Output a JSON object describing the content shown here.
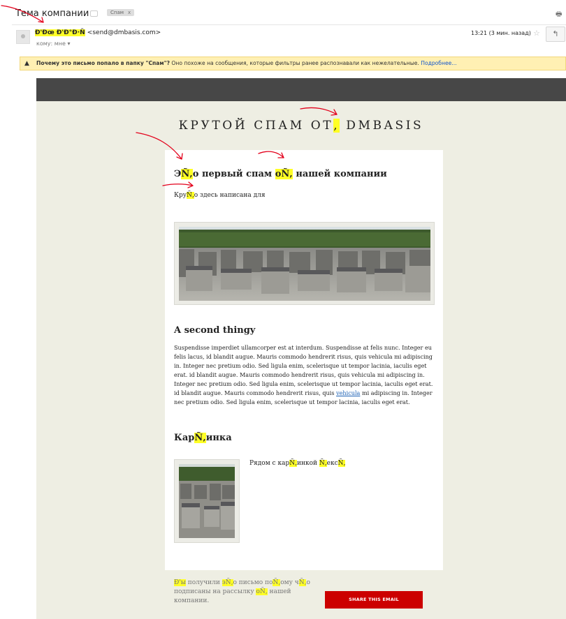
{
  "header": {
    "subject": "Тема компании",
    "label_chip": "Спам",
    "label_chip_close": "x",
    "print_icon": "printer-icon"
  },
  "message": {
    "sender_name": "Ð'Ðœ Ð'Ð°Ð·Ñ",
    "sender_email": "<send@dmbasis.com>",
    "to_label": "кому: мне",
    "time": "13:21 (3 мин. назад)",
    "star_icon": "star-icon",
    "reply_icon": "reply-icon"
  },
  "spam_warning": {
    "question": "Почему это письмо попало в папку \"Спам\"?",
    "explanation": " Оно похоже на сообщения, которые фильтры ранее распознавали как нежелательные.",
    "more_link": "Подробнее...",
    "warning_icon": "warning-icon"
  },
  "email": {
    "brand_title_pre": "КРУТОЙ СПАМ ОТ",
    "brand_title_mark": ",",
    "brand_title_post": " DMBASIS",
    "section1": {
      "title_a": "Э",
      "title_b": "Ñ‚",
      "title_c": "о первый спам ",
      "title_d": "оÑ‚",
      "title_e": " нашей компании",
      "text_a": "Кру",
      "text_b": "Ñ‚",
      "text_c": "о здесь написана для"
    },
    "section2": {
      "title": "A second thingy",
      "text_a": "Suspendisse imperdiet ullamcorper est at interdum. Suspendisse at felis nunc. Integer eu felis lacus, id blandit augue. Mauris commodo hendrerit risus, quis vehicula mi adipiscing in. Integer nec pretium odio. Sed ligula enim, scelerisque ut tempor lacinia, iaculis eget erat. id blandit augue. Mauris commodo hendrerit risus, quis vehicula mi adipiscing in. Integer nec pretium odio. Sed ligula enim, scelerisque ut tempor lacinia, iaculis eget erat. id blandit augue. Mauris commodo hendrerit risus, quis ",
      "link": "vehicula",
      "text_b": " mi adipiscing in. Integer nec pretium odio. Sed ligula enim, scelerisque ut tempor lacinia, iaculis eget erat."
    },
    "section3": {
      "title_a": "Кар",
      "title_b": "Ñ‚",
      "title_c": "инка",
      "side_a": "Рядом с кар",
      "side_b": "Ñ‚",
      "side_c": "инкой ",
      "side_d": "Ñ‚",
      "side_e": "екс",
      "side_f": "Ñ‚"
    },
    "footer": {
      "note_a": "Ð'ы",
      "note_b": " получили ",
      "note_c": "эÑ‚",
      "note_d": "о письмо по",
      "note_e": "Ñ‚",
      "note_f": "ому ч",
      "note_g": "Ñ‚",
      "note_h": "о подписаны на рассылку ",
      "note_i": "оÑ‚",
      "note_j": " нашей компании.",
      "share_button": "SHARE THIS EMAIL"
    }
  },
  "colors": {
    "email_background": "#eeeee3",
    "email_topbar": "#474747",
    "share_button": "#cc0000",
    "highlight": "#ffff26",
    "annotation_arrow": "#e3001b"
  }
}
